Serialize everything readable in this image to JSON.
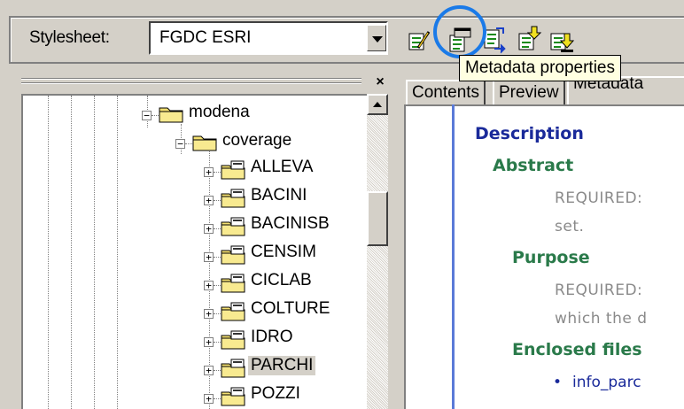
{
  "toolbar": {
    "stylesheet_label": "Stylesheet:",
    "stylesheet_value": "FGDC ESRI",
    "tooltip": "Metadata properties",
    "buttons": [
      "edit-metadata-icon",
      "metadata-properties-icon",
      "import-metadata-icon",
      "export-metadata-icon",
      "update-metadata-icon"
    ]
  },
  "tree": {
    "close": "×",
    "root": "modena",
    "child": "coverage",
    "items": [
      {
        "label": "ALLEVA"
      },
      {
        "label": "BACINI"
      },
      {
        "label": "BACINISB"
      },
      {
        "label": "CENSIM"
      },
      {
        "label": "CICLAB"
      },
      {
        "label": "COLTURE"
      },
      {
        "label": "IDRO"
      },
      {
        "label": "PARCHI"
      },
      {
        "label": "POZZI"
      }
    ],
    "selected": "PARCHI",
    "expander_collapsed": "+",
    "expander_expanded": "−"
  },
  "tabs": [
    {
      "label": "Contents"
    },
    {
      "label": "Preview"
    },
    {
      "label": "Metadata"
    }
  ],
  "metadata": {
    "description": "Description",
    "abstract": "Abstract",
    "abstract_text_1": "REQUIRED:",
    "abstract_text_2": "set.",
    "purpose": "Purpose",
    "purpose_text_1": "REQUIRED:",
    "purpose_text_2": "which the d",
    "enclosed": "Enclosed files",
    "bullet": "•",
    "file": "info_parc"
  },
  "colors": {
    "accent_circle": "#1a7ae8",
    "heading": "#1a2a9a",
    "subheading": "#2a7a4a",
    "tooltip_bg": "#ffffe1"
  }
}
